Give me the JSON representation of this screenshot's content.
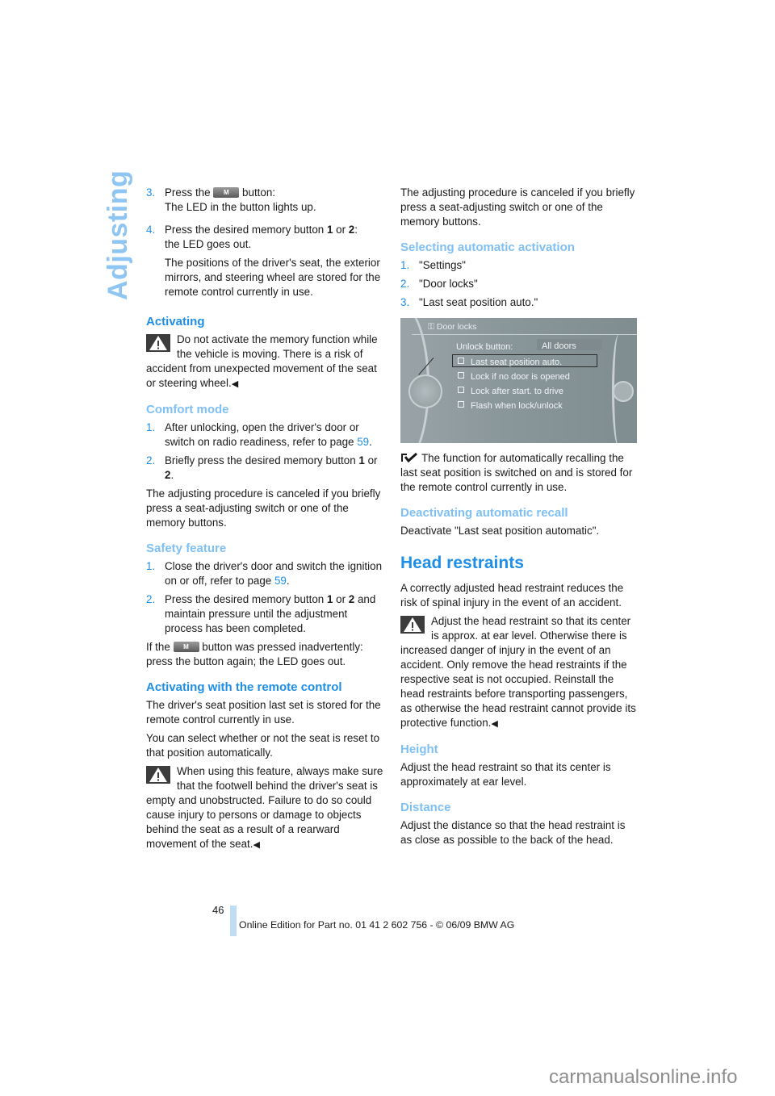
{
  "section_title": "Adjusting",
  "left": {
    "steps_top": [
      {
        "num": "3.",
        "pre": "Press the",
        "button": "M",
        "post": "button:",
        "line2": "The LED in the button lights up."
      },
      {
        "num": "4.",
        "text_pre": "Press the desired memory button ",
        "b1": "1",
        "mid": " or ",
        "b2": "2",
        "text_post": ":",
        "line2": "the LED goes out.",
        "para": "The positions of the driver's seat, the exterior mirrors, and steering wheel are stored for the remote control currently in use."
      }
    ],
    "activating": {
      "heading": "Activating",
      "warning": "Do not activate the memory function while the vehicle is moving. There is a risk of accident from unexpected movement of the seat or steering wheel.",
      "end_mark": "◀"
    },
    "comfort_mode": {
      "heading": "Comfort mode",
      "step1_num": "1.",
      "step1_text": "After unlocking, open the driver's door or switch on radio readiness, refer to page ",
      "step1_link": "59",
      "step1_end": ".",
      "step2_num": "2.",
      "step2_pre": "Briefly press the desired memory button ",
      "step2_b1": "1",
      "step2_mid": " or ",
      "step2_b2": "2",
      "step2_end": ".",
      "note": "The adjusting procedure is canceled if you briefly press a seat-adjusting switch or one of the memory buttons."
    },
    "safety": {
      "heading": "Safety feature",
      "step1_num": "1.",
      "step1_text": "Close the driver's door and switch the ignition on or off, refer to page ",
      "step1_link": "59",
      "step1_end": ".",
      "step2_num": "2.",
      "step2_pre": "Press the desired memory button ",
      "step2_b1": "1",
      "step2_mid": " or ",
      "step2_b2": "2",
      "step2_post": " and maintain pressure until the adjustment process has been completed.",
      "note_pre": "If the",
      "note_button": "M",
      "note_post": "button was pressed inadvertently: press the button again; the LED goes out."
    },
    "remote": {
      "heading": "Activating with the remote control",
      "p1": "The driver's seat position last set is stored for the remote control currently in use.",
      "p2": "You can select whether or not the seat is reset to that position automatically.",
      "warning": "When using this feature, always make sure that the footwell behind the driver's seat is empty and unobstructed. Failure to do so could cause injury to persons or damage to objects behind the seat as a result of a rearward movement of the seat.",
      "end_mark": "◀"
    }
  },
  "right": {
    "cancel_note": "The adjusting procedure is canceled if you briefly press a seat-adjusting switch or one of the memory buttons.",
    "auto_activation": {
      "heading": "Selecting automatic activation",
      "steps": [
        {
          "num": "1.",
          "text": "\"Settings\""
        },
        {
          "num": "2.",
          "text": "\"Door locks\""
        },
        {
          "num": "3.",
          "text": "\"Last seat position auto.\""
        }
      ]
    },
    "screen": {
      "title": "Door locks",
      "unlock_label": "Unlock button:",
      "unlock_value": "All doors",
      "options": [
        "Last seat position auto.",
        "Lock if no door is opened",
        "Lock after start. to drive",
        "Flash when lock/unlock"
      ]
    },
    "check_note": "The function for automatically recalling the last seat position is switched on and is stored for the remote control currently in use.",
    "deactivate": {
      "heading": "Deactivating automatic recall",
      "text": "Deactivate \"Last seat position automatic\"."
    },
    "head_restraints": {
      "heading": "Head restraints",
      "intro": "A correctly adjusted head restraint reduces the risk of spinal injury in the event of an accident.",
      "warning": "Adjust the head restraint so that its center is approx. at ear level. Otherwise there is increased danger of injury in the event of an accident. Only remove the head restraints if the respective seat is not occupied. Reinstall the head restraints before transporting passengers, as otherwise the head restraint cannot provide its protective function.",
      "end_mark": "◀"
    },
    "height": {
      "heading": "Height",
      "text": "Adjust the head restraint so that its center is approximately at ear level."
    },
    "distance": {
      "heading": "Distance",
      "text": "Adjust the distance so that the head restraint is as close as possible to the back of the head."
    }
  },
  "footer": {
    "page_number": "46",
    "edition": "Online Edition for Part no. 01 41 2 602 756 - © 06/09 BMW AG"
  },
  "watermark": "carmanualsonline.info"
}
